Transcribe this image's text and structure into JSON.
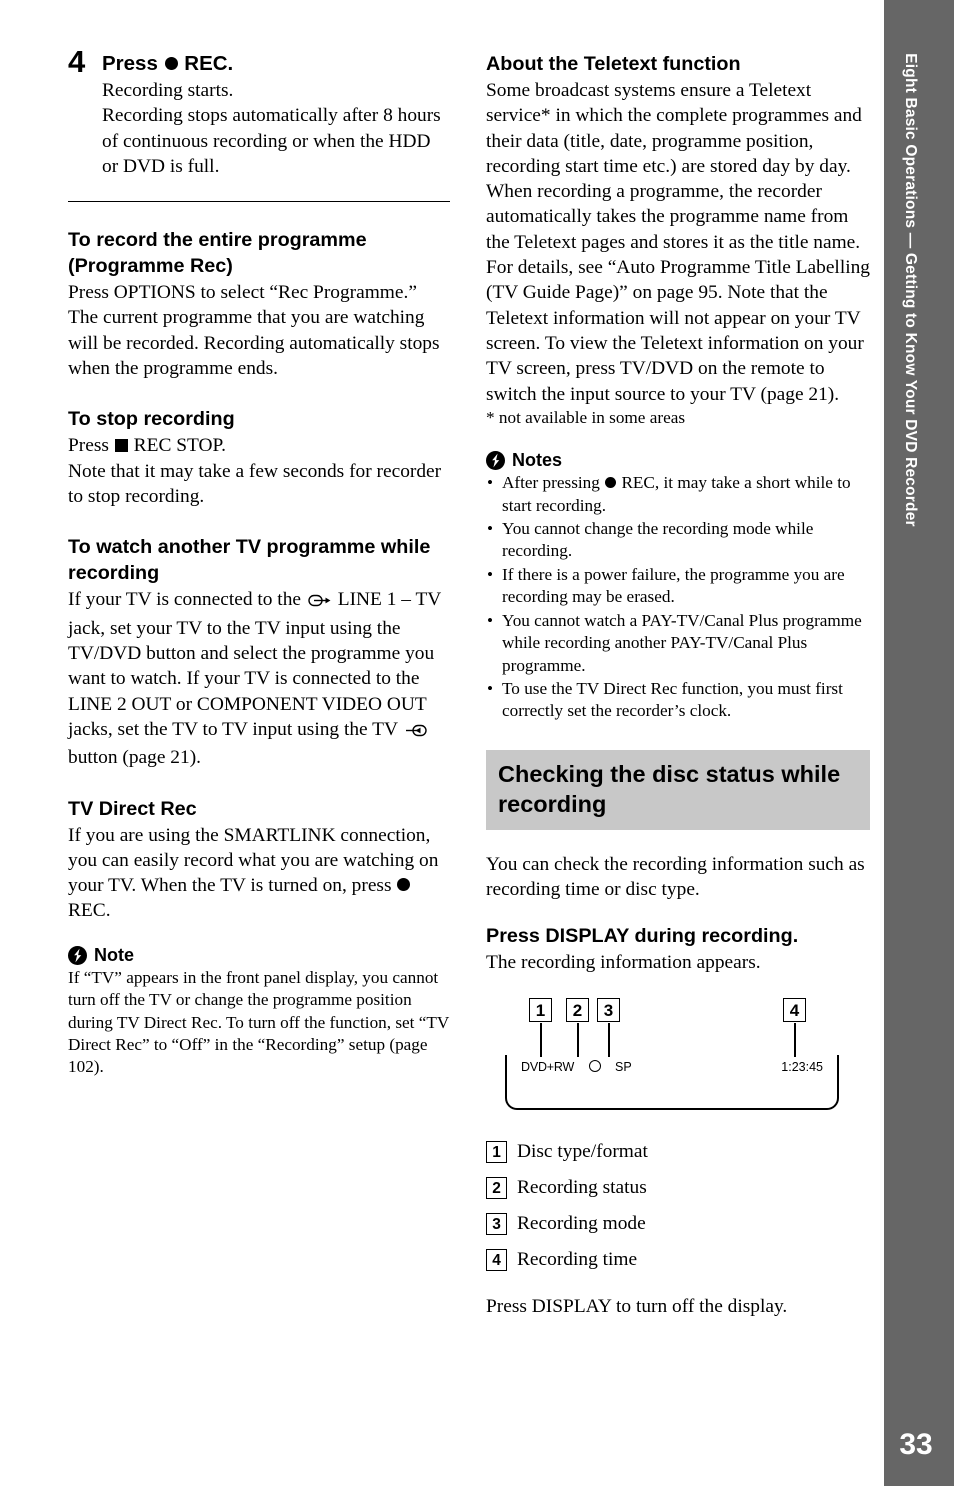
{
  "page": {
    "number": "33",
    "side_tab_label": "Eight Basic Operations — Getting to Know Your DVD Recorder"
  },
  "left_column": {
    "step": {
      "number": "4",
      "title_before": "Press",
      "title_after": "REC.",
      "lines": [
        "Recording starts.",
        "Recording stops automatically after 8 hours of continuous recording or when the HDD or DVD is full."
      ]
    },
    "programme_rec": {
      "heading_line1": "To record the entire programme",
      "heading_line2": "(Programme Rec)",
      "body": "Press OPTIONS to select “Rec Programme.” The current programme that you are watching will be recorded. Recording automatically stops when the programme ends."
    },
    "stop_recording": {
      "heading": "To stop recording",
      "press_label": "Press",
      "press_target": "REC STOP.",
      "body": "Note that it may take a few seconds for recorder to stop recording."
    },
    "watch_another": {
      "heading_line1": "To watch another TV programme while",
      "heading_line2": "recording",
      "body_part1": "If your TV is connected to the",
      "body_part2": "LINE 1 – TV jack, set your TV to the TV input using the TV/DVD button and select the programme you want to watch. If your TV is connected to the LINE 2 OUT or COMPONENT VIDEO OUT jacks, set the TV to TV input using the TV",
      "body_part3": "button (page 21)."
    },
    "tv_direct_rec": {
      "heading": "TV Direct Rec",
      "body_part1": "If you are using the SMARTLINK connection, you can easily record what you are watching on your TV. When the TV is turned on, press",
      "body_part2": "REC.",
      "note_label": "Note",
      "note_body": "If “TV” appears in the front panel display, you cannot turn off the TV or change the programme position during TV Direct Rec. To turn off the function, set “TV Direct Rec” to “Off” in the “Recording” setup (page 102)."
    }
  },
  "right_column": {
    "teletext": {
      "heading": "About the Teletext function",
      "body": "Some broadcast systems ensure a Teletext service* in which the complete programmes and their data (title, date, programme position, recording start time etc.) are stored day by day. When recording a programme, the recorder automatically takes the programme name from the Teletext pages and stores it as the title name. For details, see “Auto Programme Title Labelling (TV Guide Page)” on page 95. Note that the Teletext information will not appear on your TV screen. To view the Teletext information on your TV screen, press TV/DVD on the remote to switch the input source to your TV (page 21).",
      "footnote": "* not available in some areas"
    },
    "notes": {
      "label": "Notes",
      "items_pre": "After pressing",
      "items": [
        ", it may take a short while to start recording.",
        "You cannot change the recording mode while recording.",
        "If there is a power failure, the programme you are recording may be erased.",
        "You cannot watch a PAY-TV/Canal Plus programme while recording another PAY-TV/Canal Plus programme.",
        "To use the TV Direct Rec function, you must first correctly set the recorder’s clock."
      ],
      "first_item_tail": "REC"
    },
    "disc_status": {
      "banner_line1": "Checking the disc status while",
      "banner_line2": "recording",
      "intro": "You can check the recording information such as recording time or disc type.",
      "press_display": "Press DISPLAY during recording.",
      "press_display_sub": "The recording information appears.",
      "figure": {
        "callouts": [
          "1",
          "2",
          "3",
          "4"
        ],
        "panel": {
          "disc_type": "DVD+RW",
          "status_icon": "record-circle-icon",
          "mode": "SP",
          "time": "1:23:45"
        }
      },
      "legend": [
        {
          "num": "1",
          "label": "Disc type/format"
        },
        {
          "num": "2",
          "label": "Recording status"
        },
        {
          "num": "3",
          "label": "Recording mode"
        },
        {
          "num": "4",
          "label": "Recording time"
        }
      ],
      "closing": "Press DISPLAY to turn off the display."
    }
  }
}
